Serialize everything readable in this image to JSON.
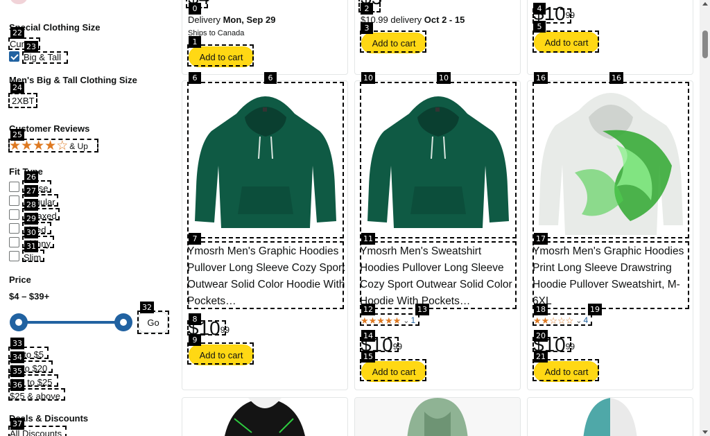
{
  "sidebar": {
    "special_size_heading": "Special Clothing Size",
    "size_option_1": "Curvy",
    "size_option_2": "Big & Tall",
    "big_tall_heading": "Men's Big & Tall Clothing Size",
    "big_tall_option": "2XBT",
    "reviews_heading": "Customer Reviews",
    "reviews_and_up": "& Up",
    "reviews_stars": 4,
    "fit_heading": "Fit Type",
    "fit_options": [
      "Loose",
      "Regular",
      "Relaxed",
      "Fitted",
      "Skinny",
      "Slim"
    ],
    "price_heading": "Price",
    "price_range": "$4 – $39+",
    "go_label": "Go",
    "price_options": [
      "Up to $5",
      "$5 to $20",
      "$20 to $25",
      "$25 & above"
    ],
    "deals_heading": "Deals & Discounts",
    "deals_option": "All Discounts"
  },
  "top_cards": [
    {
      "delivery_prefix": "Delivery ",
      "delivery_date": "Mon, Sep 29",
      "ships": "Ships to Canada",
      "add_to_cart": "Add to cart"
    },
    {
      "delivery_prefix": "$10.99 delivery ",
      "delivery_date": "Oct 2 - 15",
      "add_to_cart": "Add to cart"
    },
    {
      "price_whole": "$10",
      "price_frac": "99",
      "add_to_cart": "Add to cart"
    }
  ],
  "products": [
    {
      "title": "Ymosrh Men's Graphic Hoodies Pullover Long Sleeve Cozy Sport Outwear Solid Color Hoodie With Pockets…",
      "price_whole": "$10",
      "price_frac": "99",
      "add_to_cart": "Add to cart",
      "hoodie_color": "#0f5a44"
    },
    {
      "title": "Ymosrh Men's Sweatshirt Hoodies Pullover Long Sleeve Cozy Sport Outwear Solid Color Hoodie With Pockets…",
      "rating_stars": 5,
      "rating_count": "1",
      "price_whole": "$10",
      "price_frac": "99",
      "add_to_cart": "Add to cart",
      "hoodie_color": "#0f5a44"
    },
    {
      "title": "Ymosrh Men's Graphic Hoodies Print Long Sleeve Drawstring Hoodie Pullover Sweatshirt, M-6XL",
      "rating_stars": 2.5,
      "rating_count": "4",
      "price_whole": "$10",
      "price_frac": "99",
      "add_to_cart": "Add to cart",
      "hoodie_color": "#3fbf3f"
    }
  ],
  "annotation_labels": [
    "0",
    "1",
    "2",
    "3",
    "4",
    "5",
    "6",
    "6",
    "7",
    "8",
    "9",
    "10",
    "10",
    "11",
    "12",
    "13",
    "14",
    "15",
    "16",
    "16",
    "17",
    "18",
    "19",
    "20",
    "21",
    "22",
    "23",
    "24",
    "25",
    "26",
    "27",
    "28",
    "29",
    "30",
    "31",
    "32",
    "33",
    "34",
    "35",
    "36",
    "37"
  ],
  "colors": {
    "accent_blue": "#2162a1",
    "add_to_cart_yellow": "#ffd814",
    "star_orange": "#de7921"
  }
}
